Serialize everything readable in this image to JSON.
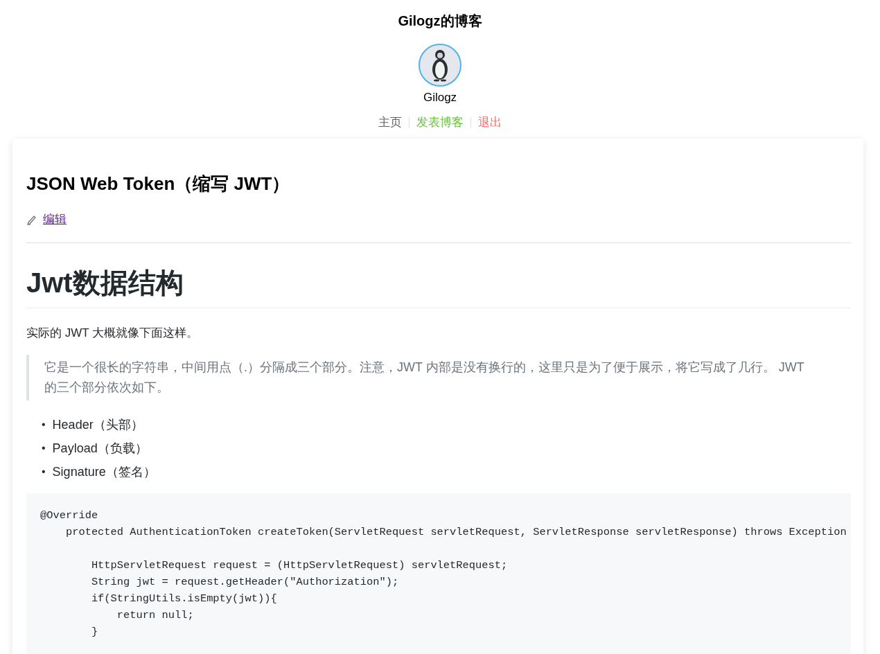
{
  "blog_title": "Gilogz的博客",
  "user": {
    "name": "Gilogz"
  },
  "nav": [
    {
      "label": "主页",
      "color": "#606266"
    },
    {
      "label": "发表博客",
      "color": "#67c23a"
    },
    {
      "label": "退出",
      "color": "#f56c6c"
    }
  ],
  "post": {
    "title": "JSON Web Token（缩写 JWT）",
    "edit_link": "编辑",
    "heading": "Jwt数据结构",
    "paragraph": "实际的 JWT 大概就像下面这样。",
    "quote": "它是一个很长的字符串，中间用点（.）分隔成三个部分。注意，JWT 内部是没有换行的，这里只是为了便于展示，将它写成了几行。 JWT 的三个部分依次如下。",
    "list": [
      {
        "marker": "•",
        "text": "Header（头部）"
      },
      {
        "marker": "•",
        "text": "Payload（负载）"
      },
      {
        "marker": "•",
        "text": "Signature（签名）"
      }
    ],
    "code": "@Override\n    protected AuthenticationToken createToken(ServletRequest servletRequest, ServletResponse servletResponse) throws Exception\n\n        HttpServletRequest request = (HttpServletRequest) servletRequest;\n        String jwt = request.getHeader(\"Authorization\");\n        if(StringUtils.isEmpty(jwt)){\n            return null;\n        }"
  }
}
